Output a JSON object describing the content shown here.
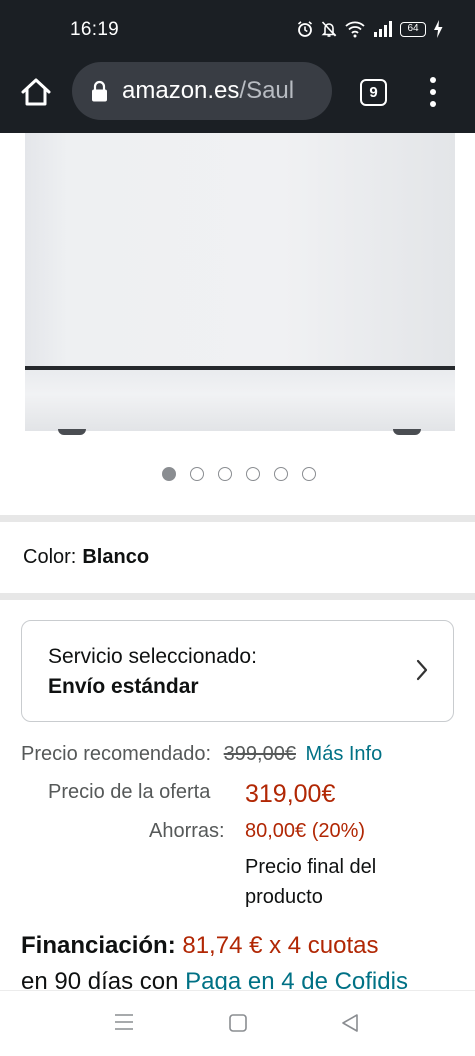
{
  "status_bar": {
    "time": "16:19",
    "battery_level": "64",
    "icons": [
      "alarm-icon",
      "mute-icon",
      "wifi-icon",
      "signal-icon",
      "battery-icon",
      "charging-icon"
    ]
  },
  "browser": {
    "domain": "amazon.es",
    "path": "/Saul",
    "tab_count": "9"
  },
  "carousel": {
    "total": 6,
    "active_index": 0
  },
  "color": {
    "label": "Color:",
    "value": "Blanco"
  },
  "service": {
    "title": "Servicio seleccionado:",
    "value": "Envío estándar"
  },
  "pricing": {
    "recommended_label": "Precio recomendado:",
    "recommended_price": "399,00€",
    "more_info": "Más Info",
    "offer_label": "Precio de la oferta",
    "offer_price": "319,00€",
    "savings_label": "Ahorras:",
    "savings_value": "80,00€ (20%)",
    "final_note_line1": "Precio final del",
    "final_note_line2": "producto"
  },
  "financing": {
    "label": "Financiación:",
    "amount": "81,74 € x 4 cuotas",
    "line2_prefix": "en 90 días con",
    "provider_link": "Paga en 4 de Cofidis"
  },
  "colors": {
    "accent_red": "#b12704",
    "link_teal": "#007185",
    "top_bar": "#1b1f24"
  }
}
